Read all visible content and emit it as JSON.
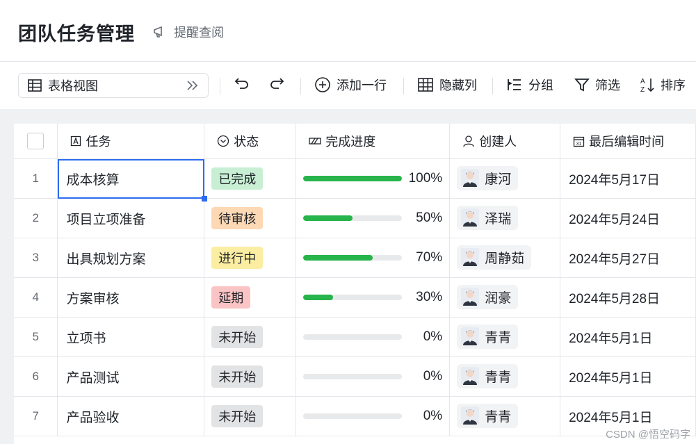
{
  "header": {
    "title": "团队任务管理",
    "reminder_label": "提醒查阅"
  },
  "toolbar": {
    "view_label": "表格视图",
    "add_row": "添加一行",
    "hide_columns": "隐藏列",
    "group": "分组",
    "filter": "筛选",
    "sort": "排序"
  },
  "columns": {
    "task": "任务",
    "status": "状态",
    "progress": "完成进度",
    "creator": "创建人",
    "updated": "最后编辑时间"
  },
  "rows": [
    {
      "num": "1",
      "task": "成本核算",
      "status": "已完成",
      "progress": 1.0,
      "pct": "100%",
      "creator": "康河",
      "date": "2024年5月17日"
    },
    {
      "num": "2",
      "task": "项目立项准备",
      "status": "待审核",
      "progress": 0.5,
      "pct": "50%",
      "creator": "泽瑞",
      "date": "2024年5月24日"
    },
    {
      "num": "3",
      "task": "出具规划方案",
      "status": "进行中",
      "progress": 0.7,
      "pct": "70%",
      "creator": "周静茹",
      "date": "2024年5月27日"
    },
    {
      "num": "4",
      "task": "方案审核",
      "status": "延期",
      "progress": 0.3,
      "pct": "30%",
      "creator": "润豪",
      "date": "2024年5月28日"
    },
    {
      "num": "5",
      "task": "立项书",
      "status": "未开始",
      "progress": 0.0,
      "pct": "0%",
      "creator": "青青",
      "date": "2024年5月1日"
    },
    {
      "num": "6",
      "task": "产品测试",
      "status": "未开始",
      "progress": 0.0,
      "pct": "0%",
      "creator": "青青",
      "date": "2024年5月1日"
    },
    {
      "num": "7",
      "task": "产品验收",
      "status": "未开始",
      "progress": 0.0,
      "pct": "0%",
      "creator": "青青",
      "date": "2024年5月1日"
    }
  ],
  "status_colors": {
    "已完成": {
      "bg": "#c8efd4",
      "fg": "#1f2329"
    },
    "待审核": {
      "bg": "#fdd8b4",
      "fg": "#1f2329"
    },
    "进行中": {
      "bg": "#fbeea2",
      "fg": "#1f2329"
    },
    "延期": {
      "bg": "#fbc4c4",
      "fg": "#1f2329"
    },
    "未开始": {
      "bg": "#e2e3e5",
      "fg": "#1f2329"
    }
  },
  "accent_color": "#2c6bf0",
  "progress_color": "#27b44b",
  "watermark": "CSDN @悟空码字"
}
